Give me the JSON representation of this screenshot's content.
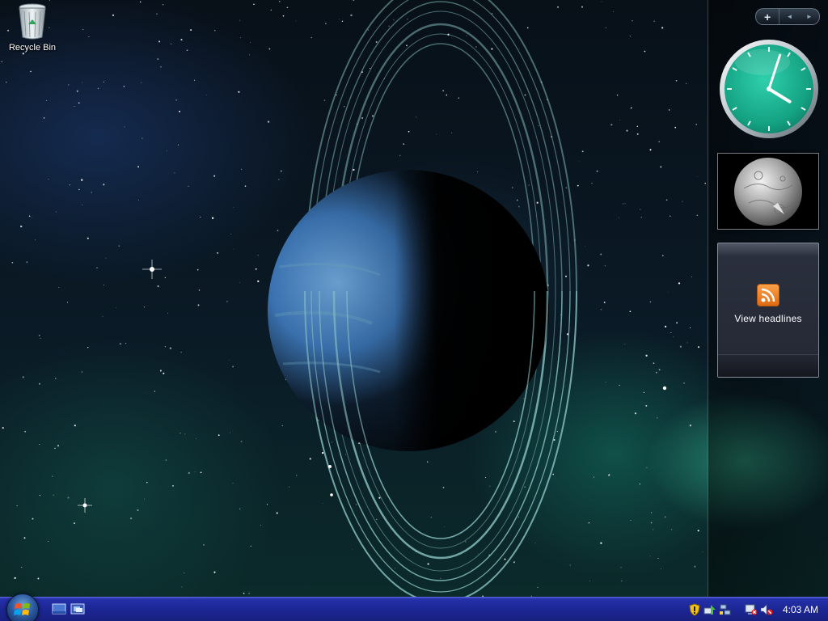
{
  "desktop": {
    "icons": [
      {
        "label": "Recycle Bin",
        "icon": "recycle-bin-icon"
      }
    ]
  },
  "sidebar": {
    "controls": {
      "add_label": "+",
      "prev_icon": "◄",
      "next_icon": "►"
    },
    "clock": {
      "hour": 4,
      "minute": 3,
      "face_color": "#1fae8f"
    },
    "slideshow": {
      "icon": "moon-image"
    },
    "feed": {
      "label": "View headlines",
      "icon": "rss-icon"
    }
  },
  "taskbar": {
    "start_icon": "windows-logo-icon",
    "quick_launch": [
      "show-desktop-icon",
      "switch-windows-icon"
    ],
    "tray_icons": [
      "security-shield-icon",
      "network-icon",
      "network-status-icon",
      "display-icon",
      "volume-muted-icon"
    ],
    "time": "4:03 AM"
  },
  "colors": {
    "taskbar": "#1c2694",
    "clock_face": "#1fae8f",
    "rss": "#f08a2a"
  }
}
